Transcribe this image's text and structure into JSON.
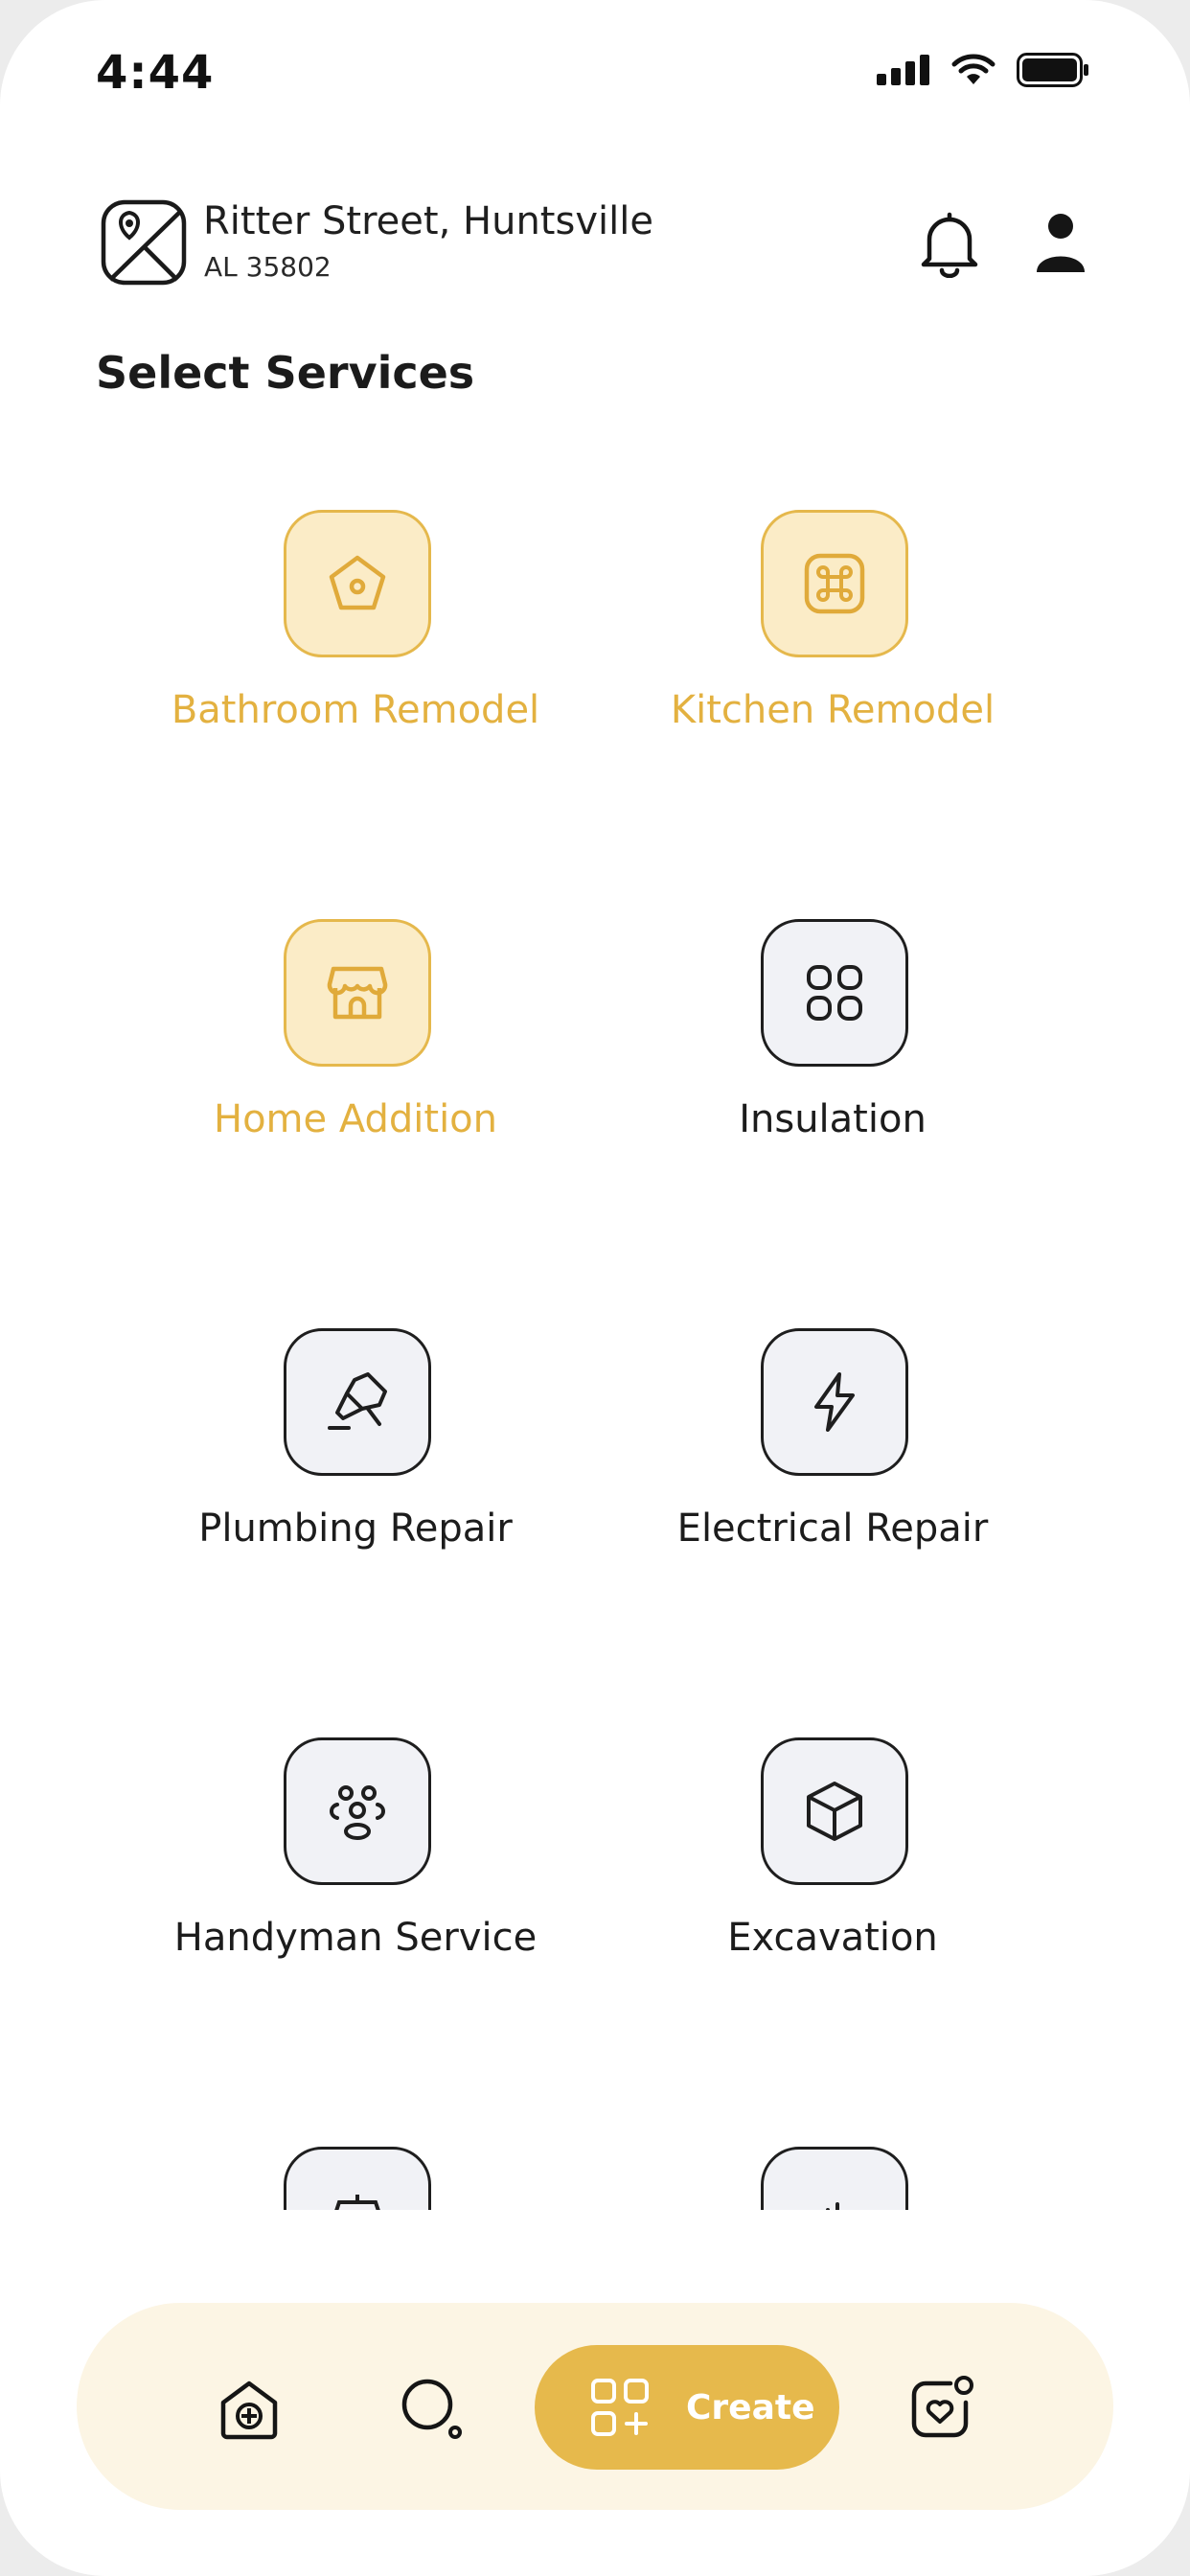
{
  "status_bar": {
    "time": "4:44"
  },
  "header": {
    "address_line1": "Ritter Street, Huntsville",
    "address_line2": "AL 35802"
  },
  "section_title": "Select Services",
  "services": [
    {
      "label": "Bathroom Remodel",
      "icon": "home-pentagon-icon",
      "selected": true
    },
    {
      "label": "Kitchen Remodel",
      "icon": "command-icon",
      "selected": true
    },
    {
      "label": "Home Addition",
      "icon": "shop-icon",
      "selected": true
    },
    {
      "label": "Insulation",
      "icon": "category-grid-icon",
      "selected": false
    },
    {
      "label": "Plumbing Repair",
      "icon": "brush-icon",
      "selected": false
    },
    {
      "label": "Electrical Repair",
      "icon": "lightning-icon",
      "selected": false
    },
    {
      "label": "Handyman Service",
      "icon": "people-icon",
      "selected": false
    },
    {
      "label": "Excavation",
      "icon": "box-icon",
      "selected": false
    }
  ],
  "bottom_nav": {
    "create_label": "Create"
  },
  "colors": {
    "accent": "#e6b94c",
    "accent_light": "#fbecc7",
    "selected_text": "#e3b140",
    "nav_background": "#fcf5e4",
    "tile_background": "#f1f2f6"
  }
}
